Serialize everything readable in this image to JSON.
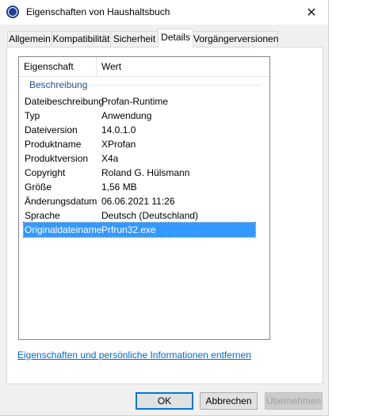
{
  "window": {
    "title": "Eigenschaften von Haushaltsbuch",
    "app_icon": "profan-icon",
    "close_glyph": "✕"
  },
  "tabs": [
    {
      "label": "Allgemein",
      "active": false
    },
    {
      "label": "Kompatibilität",
      "active": false
    },
    {
      "label": "Sicherheit",
      "active": false
    },
    {
      "label": "Details",
      "active": true
    },
    {
      "label": "Vorgängerversionen",
      "active": false
    }
  ],
  "listview": {
    "columns": {
      "property": "Eigenschaft",
      "value": "Wert"
    },
    "group": "Beschreibung",
    "rows": [
      {
        "property": "Dateibeschreibung",
        "value": "Profan-Runtime"
      },
      {
        "property": "Typ",
        "value": "Anwendung"
      },
      {
        "property": "Dateiversion",
        "value": "14.0.1.0"
      },
      {
        "property": "Produktname",
        "value": "XProfan"
      },
      {
        "property": "Produktversion",
        "value": "X4a"
      },
      {
        "property": "Copyright",
        "value": "Roland G. Hülsmann"
      },
      {
        "property": "Größe",
        "value": "1,56 MB"
      },
      {
        "property": "Änderungsdatum",
        "value": "06.06.2021 11:26"
      },
      {
        "property": "Sprache",
        "value": "Deutsch (Deutschland)"
      },
      {
        "property": "Originaldateiname",
        "value": "Prfrun32.exe"
      }
    ],
    "selected_row": 9
  },
  "remove_link": "Eigenschaften und persönliche Informationen entfernen",
  "buttons": {
    "ok": "OK",
    "cancel": "Abbrechen",
    "apply": "Übernehmen"
  },
  "colors": {
    "selection": "#3399ff",
    "link": "#0066cc",
    "group_header": "#1e4e9e",
    "default_button_border": "#0078d7"
  }
}
